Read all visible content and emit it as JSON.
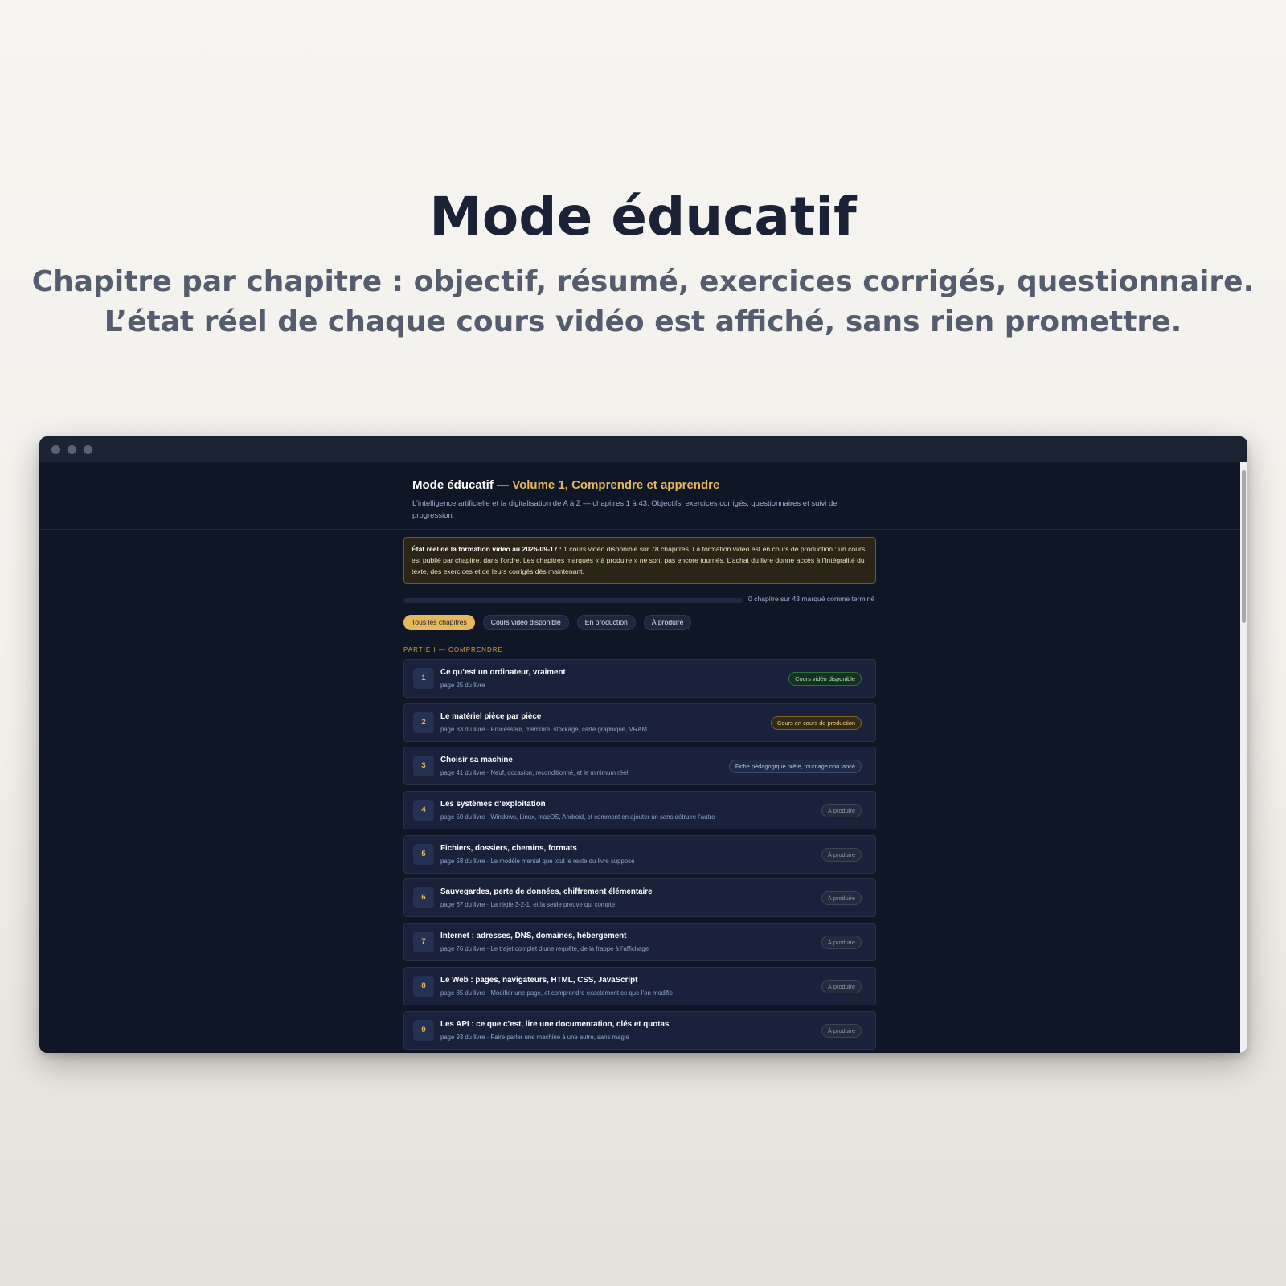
{
  "hero": {
    "title": "Mode éducatif",
    "subtitle_line1": "Chapitre par chapitre : objectif, résumé, exercices corrigés, questionnaire.",
    "subtitle_line2": "L’état réel de chaque cours vidéo est affiché, sans rien promettre."
  },
  "app": {
    "title_main": "Mode éducatif — ",
    "title_accent": "Volume 1, Comprendre et apprendre",
    "description": "L’intelligence artificielle et la digitalisation de A à Z — chapitres 1 à 43. Objectifs, exercices corrigés, questionnaires et suivi de progression."
  },
  "notice": {
    "label": "État réel de la formation vidéo au 2026-09-17 :",
    "text": " 1 cours vidéo disponible sur 78 chapitres. La formation vidéo est en cours de production : un cours est publié par chapitre, dans l’ordre. Les chapitres marqués « à produire » ne sont pas encore tournés. L’achat du livre donne accès à l’intégralité du texte, des exercices et de leurs corrigés dès maintenant."
  },
  "progress": {
    "fraction": 0,
    "label": "0 chapitre sur 43 marqué comme terminé"
  },
  "filters": [
    {
      "label": "Tous les chapitres",
      "active": true
    },
    {
      "label": "Cours vidéo disponible",
      "active": false
    },
    {
      "label": "En production",
      "active": false
    },
    {
      "label": "À produire",
      "active": false
    }
  ],
  "part": {
    "label": "PARTIE I — COMPRENDRE"
  },
  "chapters": [
    {
      "num": "1",
      "title": "Ce qu’est un ordinateur, vraiment",
      "meta": "page 25 du livre",
      "badge": "Cours vidéo disponible",
      "status": "available"
    },
    {
      "num": "2",
      "title": "Le matériel pièce par pièce",
      "meta": "page 33 du livre · Processeur, mémoire, stockage, carte graphique, VRAM",
      "badge": "Cours en cours de production",
      "status": "production"
    },
    {
      "num": "3",
      "title": "Choisir sa machine",
      "meta": "page 41 du livre · Neuf, occasion, reconditionné, et le minimum réel",
      "badge": "Fiche pédagogique prête, tournage non lancé",
      "status": "sheet"
    },
    {
      "num": "4",
      "title": "Les systèmes d’exploitation",
      "meta": "page 50 du livre · Windows, Linux, macOS, Android, et comment en ajouter un sans détruire l’autre",
      "badge": "À produire",
      "status": "todo"
    },
    {
      "num": "5",
      "title": "Fichiers, dossiers, chemins, formats",
      "meta": "page 58 du livre · Le modèle mental que tout le reste du livre suppose",
      "badge": "À produire",
      "status": "todo"
    },
    {
      "num": "6",
      "title": "Sauvegardes, perte de données, chiffrement élémentaire",
      "meta": "page 67 du livre · La règle 3-2-1, et la seule preuve qui compte",
      "badge": "À produire",
      "status": "todo"
    },
    {
      "num": "7",
      "title": "Internet : adresses, DNS, domaines, hébergement",
      "meta": "page 76 du livre · Le trajet complet d’une requête, de la frappe à l’affichage",
      "badge": "À produire",
      "status": "todo"
    },
    {
      "num": "8",
      "title": "Le Web : pages, navigateurs, HTML, CSS, JavaScript",
      "meta": "page 85 du livre · Modifier une page, et comprendre exactement ce que l’on modifie",
      "badge": "À produire",
      "status": "todo"
    },
    {
      "num": "9",
      "title": "Les API : ce que c’est, lire une documentation, clés et quotas",
      "meta": "page 93 du livre · Faire parler une machine à une autre, sans magie",
      "badge": "À produire",
      "status": "todo"
    }
  ],
  "colors": {
    "accent": "#e5b75e",
    "background": "#0f1727",
    "available": "#a8e6b7",
    "production": "#f2d28c"
  }
}
